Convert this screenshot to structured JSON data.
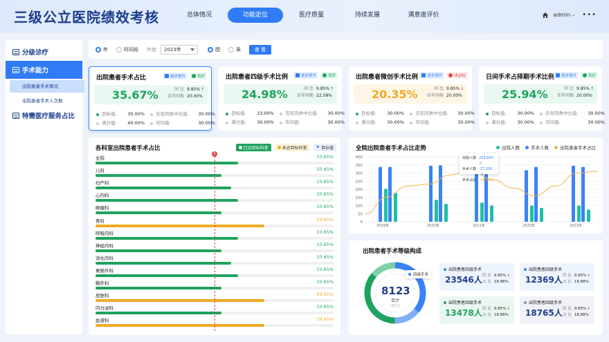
{
  "app": {
    "title": "三级公立医院绩效考核",
    "user": "admin"
  },
  "nav": [
    "总体情况",
    "功能定位",
    "医疗质量",
    "持续发展",
    "满意度评价"
  ],
  "sidebar": {
    "items": [
      "分级诊疗",
      "手术能力",
      "特需医疗服务占比"
    ],
    "sub_items": [
      "出院患者手术情况",
      "出院患者手术人次数"
    ]
  },
  "filter": {
    "period_options": [
      "年",
      "时间段"
    ],
    "year_label": "年度",
    "year_value": "2023年",
    "view_options": [
      "图",
      "表"
    ],
    "query_label": "查 看"
  },
  "kpis": [
    {
      "title": "出院患者手术占比",
      "badges": [
        "逐步提升",
        "良好"
      ],
      "value": "35.67%",
      "yoy_label": "同 比",
      "yoy": "9.85%",
      "yoy_dir": "↑",
      "last_label": "去年同期",
      "last": "20.00%",
      "target_label": "目标值:",
      "target": "30.00%",
      "mid_label": "去年同类中位值:",
      "mid": "30.00%",
      "full_label": "满分值:",
      "full": "40.00%",
      "city_label": "市均值:",
      "city": "30.00%"
    },
    {
      "title": "出院患者四级手术比例",
      "badges": [
        "逐步提升",
        "良好"
      ],
      "value": "24.98%",
      "yoy_label": "同 比",
      "yoy": "9.85%",
      "yoy_dir": "↑",
      "last_label": "去年同期",
      "last": "22.58%",
      "target_label": "目标值:",
      "target": "23.00%",
      "mid_label": "去年同类中位值:",
      "mid": "30.00%",
      "full_label": "满分值:",
      "full": "30.00%",
      "city_label": "市均值:",
      "city": "30.00%"
    },
    {
      "title": "出院患者微创手术比例",
      "badges": [
        "逐步提升",
        "未达标"
      ],
      "value": "20.35%",
      "yoy_label": "同 比",
      "yoy": "9.85%",
      "yoy_dir": "↓",
      "last_label": "去年同期",
      "last": "20.00%",
      "target_label": "目标值:",
      "target": "30.00%",
      "mid_label": "去年同类中位值:",
      "mid": "30.00%",
      "full_label": "满分值:",
      "full": "30.00%",
      "city_label": "市均值:",
      "city": "30.00%"
    },
    {
      "title": "日间手术占择期手术比例",
      "badges": [
        "逐步提升",
        "良好"
      ],
      "value": "25.94%",
      "yoy_label": "同 比",
      "yoy": "9.85%",
      "yoy_dir": "↑",
      "last_label": "去年同期",
      "last": "20.00%",
      "target_label": "目标值:",
      "target": "30.00%",
      "mid_label": "去年同类中位值:",
      "mid": "30.00%",
      "full_label": "满分值:",
      "full": "30.00%",
      "city_label": "市均值:",
      "city": "30.00%"
    }
  ],
  "dept_panel": {
    "title": "各科室出院患者手术占比",
    "legend": [
      "已达目标科室",
      "未达目标科室",
      "目标值"
    ],
    "target_mark": "!",
    "rows": [
      {
        "name": "全院",
        "value": "33.65%",
        "level": 0.6,
        "met": true
      },
      {
        "name": "儿科",
        "value": "33.65%",
        "level": 0.53,
        "met": true
      },
      {
        "name": "妇产科",
        "value": "33.65%",
        "level": 0.57,
        "met": true
      },
      {
        "name": "心内科",
        "value": "33.65%",
        "level": 0.6,
        "met": true
      },
      {
        "name": "肿瘤科",
        "value": "33.65%",
        "level": 0.53,
        "met": true
      },
      {
        "name": "骨科",
        "value": "29.65%",
        "level": 0.71,
        "met": false
      },
      {
        "name": "呼吸内科",
        "value": "33.65%",
        "level": 0.6,
        "met": true
      },
      {
        "name": "神经内科",
        "value": "33.65%",
        "level": 0.53,
        "met": true
      },
      {
        "name": "消化内科",
        "value": "33.65%",
        "level": 0.57,
        "met": true
      },
      {
        "name": "胃肠外科",
        "value": "33.65%",
        "level": 0.6,
        "met": true
      },
      {
        "name": "胸外科",
        "value": "33.65%",
        "level": 0.53,
        "met": true
      },
      {
        "name": "皮肤科",
        "value": "29.65%",
        "level": 0.71,
        "met": false
      },
      {
        "name": "内分泌科",
        "value": "33.65%",
        "level": 0.53,
        "met": true
      },
      {
        "name": "血液科",
        "value": "29.65%",
        "level": 0.71,
        "met": false
      }
    ]
  },
  "trend": {
    "title": "全院出院患者手术占比走势",
    "tooltip": {
      "rows": [
        {
          "label": "出院人数",
          "value": "253,655人"
        },
        {
          "label": "手术人数",
          "value": "27,326人"
        },
        {
          "label": "手术占比",
          "value": "33.18%"
        }
      ]
    }
  },
  "chart_data": {
    "type": "bar",
    "title": "全院出院患者手术占比走势",
    "x_tick_labels": [
      "2019年",
      "2020年",
      "2021年",
      "2022年",
      "2023年"
    ],
    "yticks": [
      0,
      50,
      100,
      150,
      200,
      250,
      300,
      350,
      400
    ],
    "ylim": [
      0,
      400
    ],
    "grid": true,
    "legend_position": "top-right",
    "series": [
      {
        "name": "出院人数",
        "color": "#3b82f6",
        "type": "bar",
        "values": [
          338,
          338,
          345,
          348,
          338,
          345,
          318,
          338,
          345,
          338
        ]
      },
      {
        "name": "手术人数",
        "color": "#1fbfa8",
        "type": "bar",
        "values": [
          203,
          178,
          135,
          110,
          118,
          100,
          100,
          85,
          100,
          75
        ]
      },
      {
        "name": "出院患者手术占比",
        "color": "#f4b24c",
        "type": "line",
        "values": [
          0.12,
          0.38,
          0.55,
          0.58,
          0.72,
          0.8,
          0.65,
          0.52,
          0.4,
          0.55,
          0.75,
          0.78
        ]
      }
    ]
  },
  "grade_panel": {
    "title": "出院患者手术等级构成",
    "total": "8123",
    "total_label": "合计",
    "total_unit": "(万人)",
    "tag": "四级手术",
    "donut": [
      {
        "label": "出院患者四级手术",
        "share": 0.36,
        "color": "#3b82f6"
      },
      {
        "label": "出院患者四级手术",
        "share": 0.14,
        "color": "#7fb0f7"
      },
      {
        "label": "出院患者四级手术",
        "share": 0.36,
        "color": "#1ea35f"
      },
      {
        "label": "出院患者四级手术",
        "share": 0.14,
        "color": "#7dd1a8"
      }
    ],
    "cards": [
      {
        "title": "出院患者四级手术",
        "value": "23546人",
        "yoy_label": "同 比",
        "yoy": "9.85%",
        "dir": "↓",
        "share_label": "占 比",
        "share": "18.88%",
        "color": "#3b82f6"
      },
      {
        "title": "出院患者四级手术",
        "value": "12369人",
        "yoy_label": "同 比",
        "yoy": "9.85%",
        "dir": "↓",
        "share_label": "占 比",
        "share": "18.88%",
        "color": "#3b82f6"
      },
      {
        "title": "出院患者四级手术",
        "value": "13478人",
        "yoy_label": "同 比",
        "yoy": "9.85%",
        "dir": "↓",
        "share_label": "占 比",
        "share": "18.88%",
        "color": "#1ea35f"
      },
      {
        "title": "出院患者四级手术",
        "value": "18765人",
        "yoy_label": "同 比",
        "yoy": "9.85%",
        "dir": "↓",
        "share_label": "占 比",
        "share": "18.88%",
        "color": "#8b8bb5"
      }
    ]
  },
  "colors": {
    "primary": "#2f7cf6",
    "green": "#1ea35f",
    "yellow": "#f0a925",
    "red": "#e04848",
    "teal": "#1fbfa8"
  }
}
